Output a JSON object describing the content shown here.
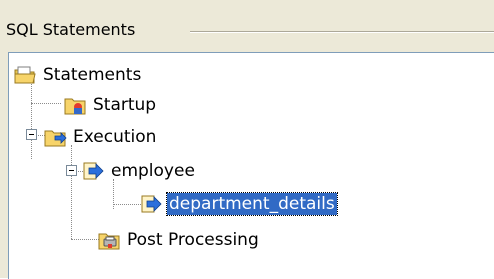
{
  "panel": {
    "title": "SQL Statements"
  },
  "tree": {
    "root": {
      "label": "Statements",
      "icon": "folder-open-icon"
    },
    "startup": {
      "label": "Startup",
      "icon": "startup-folder-icon"
    },
    "execution": {
      "label": "Execution",
      "icon": "execution-folder-icon",
      "expanded": true
    },
    "employee": {
      "label": "employee",
      "icon": "statement-arrow-icon",
      "expanded": true
    },
    "dept": {
      "label": "department_details",
      "icon": "statement-arrow-icon",
      "selected": true
    },
    "post": {
      "label": "Post Processing",
      "icon": "post-processing-folder-icon"
    }
  },
  "colors": {
    "selection": "#316ac5",
    "panel_bg": "#ece9d8",
    "arrow": "#2b6fdc",
    "folder": "#f7d46a"
  }
}
